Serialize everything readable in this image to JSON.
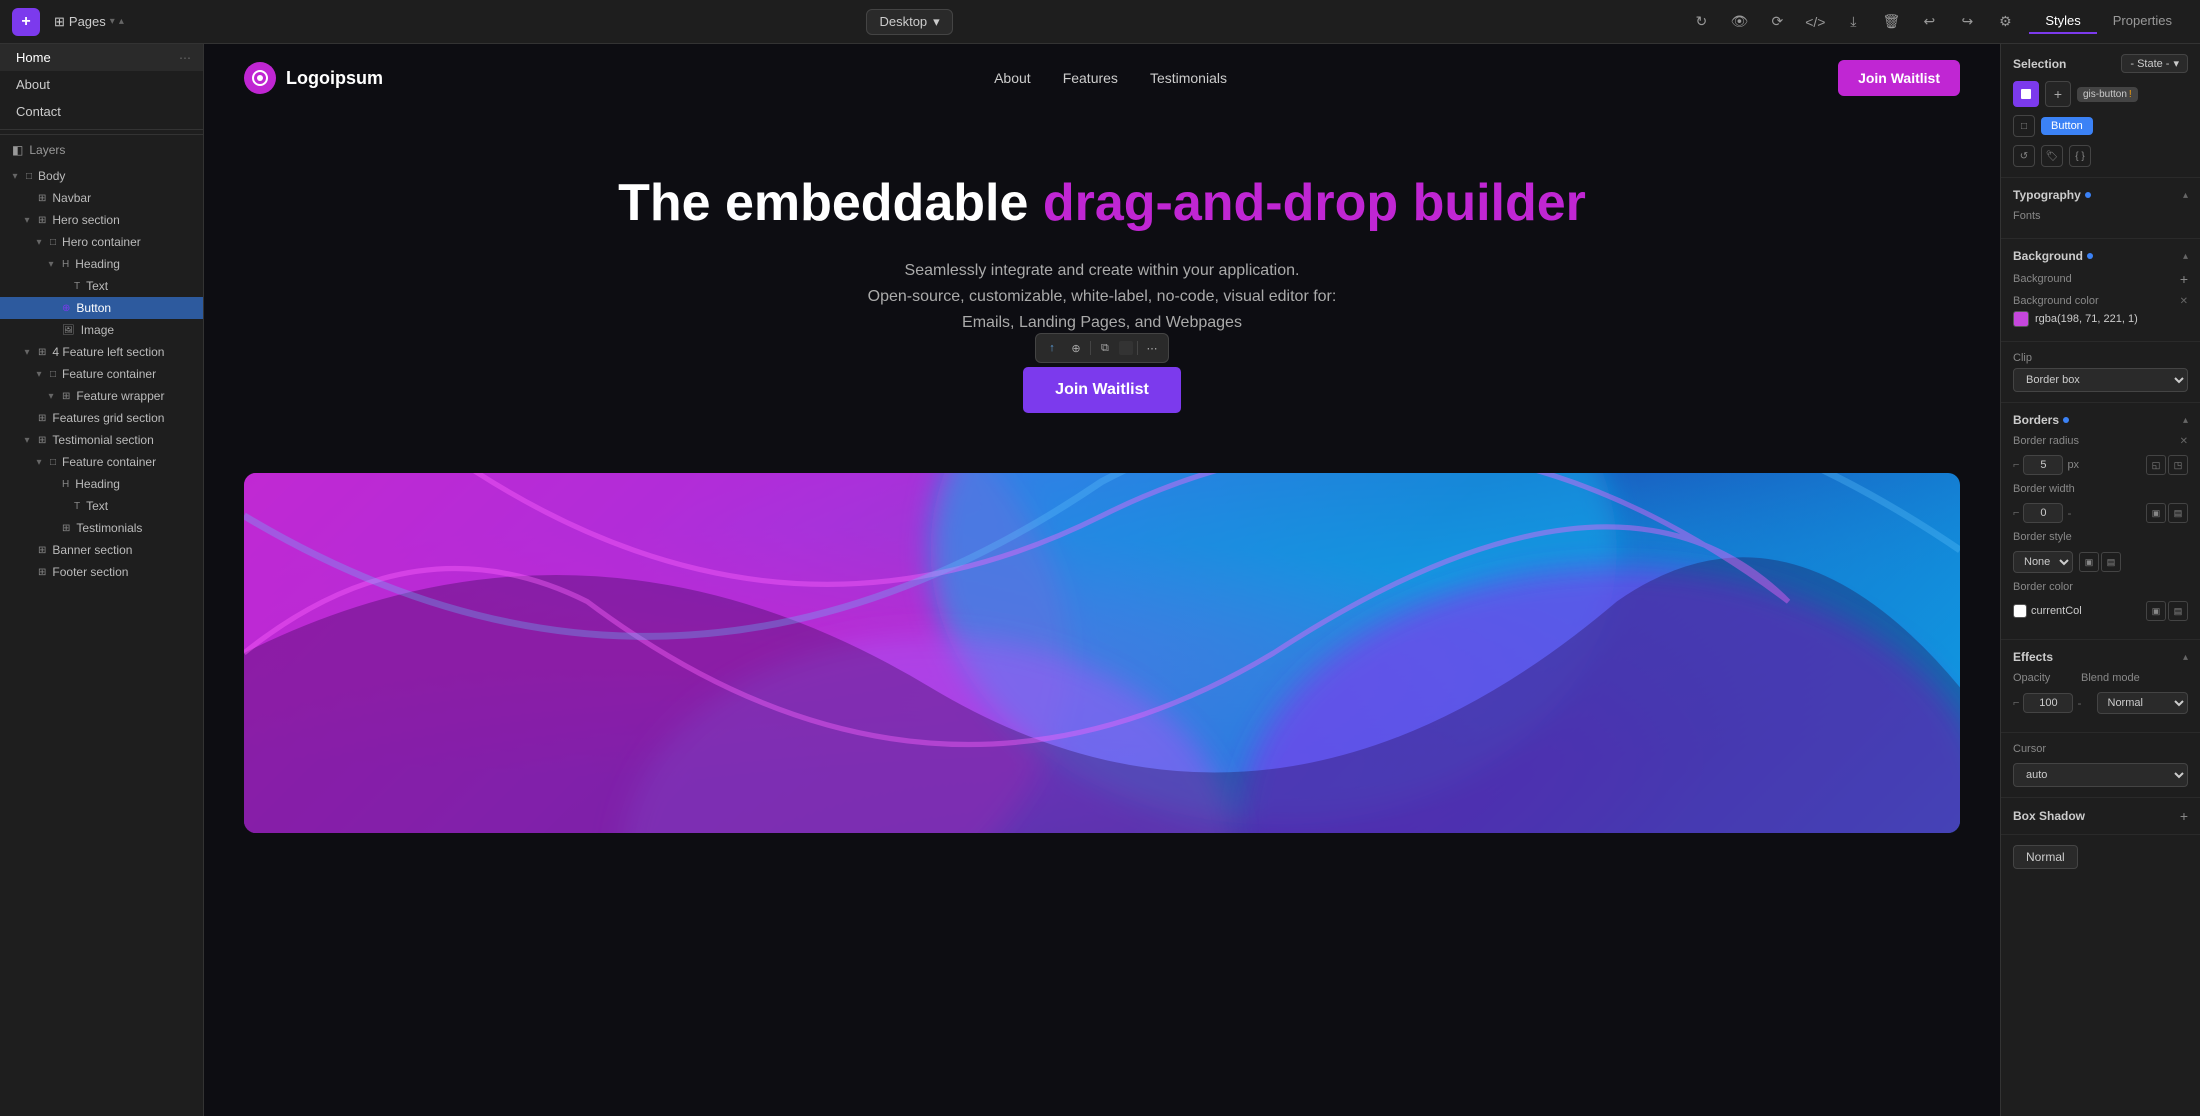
{
  "app": {
    "title": "Pages",
    "add_btn": "+",
    "device": "Desktop",
    "styles_tab": "Styles",
    "properties_tab": "Properties"
  },
  "pages": [
    {
      "id": "home",
      "label": "Home",
      "active": true
    },
    {
      "id": "about",
      "label": "About",
      "active": false
    },
    {
      "id": "contact",
      "label": "Contact",
      "active": false
    }
  ],
  "layers": {
    "title": "Layers",
    "items": [
      {
        "id": "body",
        "label": "Body",
        "indent": 0,
        "type": "box",
        "toggle": "▾",
        "expanded": true
      },
      {
        "id": "navbar",
        "label": "Navbar",
        "indent": 1,
        "type": "grid",
        "toggle": ""
      },
      {
        "id": "hero-section",
        "label": "Hero section",
        "indent": 1,
        "type": "grid",
        "toggle": "▾",
        "expanded": true
      },
      {
        "id": "hero-container",
        "label": "Hero container",
        "indent": 2,
        "type": "box",
        "toggle": "▾",
        "expanded": true
      },
      {
        "id": "heading",
        "label": "Heading",
        "indent": 3,
        "type": "heading",
        "toggle": "▾",
        "expanded": false
      },
      {
        "id": "text",
        "label": "Text",
        "indent": 4,
        "type": "text",
        "toggle": ""
      },
      {
        "id": "button",
        "label": "Button",
        "indent": 3,
        "type": "link",
        "toggle": "",
        "selected": true
      },
      {
        "id": "image",
        "label": "Image",
        "indent": 3,
        "type": "image",
        "toggle": ""
      },
      {
        "id": "feature-left-section",
        "label": "4 Feature left section",
        "indent": 1,
        "type": "grid",
        "toggle": "▾",
        "expanded": true
      },
      {
        "id": "feature-container",
        "label": "Feature container",
        "indent": 2,
        "type": "box",
        "toggle": "▾",
        "expanded": true
      },
      {
        "id": "feature-wrapper",
        "label": "Feature wrapper",
        "indent": 3,
        "type": "grid",
        "toggle": "▾",
        "expanded": false
      },
      {
        "id": "features-grid-section",
        "label": "Features grid section",
        "indent": 1,
        "type": "grid",
        "toggle": ""
      },
      {
        "id": "testimonial-section",
        "label": "Testimonial section",
        "indent": 1,
        "type": "grid",
        "toggle": "▾",
        "expanded": true
      },
      {
        "id": "feature-container-2",
        "label": "Feature container",
        "indent": 2,
        "type": "box",
        "toggle": "▾",
        "expanded": true
      },
      {
        "id": "heading-2",
        "label": "Heading",
        "indent": 3,
        "type": "heading",
        "toggle": ""
      },
      {
        "id": "text-2",
        "label": "Text",
        "indent": 4,
        "type": "text",
        "toggle": ""
      },
      {
        "id": "testimonials",
        "label": "Testimonials",
        "indent": 3,
        "type": "grid",
        "toggle": ""
      },
      {
        "id": "banner-section",
        "label": "Banner section",
        "indent": 1,
        "type": "grid",
        "toggle": ""
      },
      {
        "id": "footer-section",
        "label": "Footer section",
        "indent": 1,
        "type": "grid",
        "toggle": ""
      }
    ]
  },
  "website": {
    "logo": "Logoipsum",
    "nav_links": [
      "About",
      "Features",
      "Testimonials"
    ],
    "cta_btn": "Join Waitlist",
    "hero_title_normal": "The embeddable ",
    "hero_title_accent": "drag-and-drop builder",
    "hero_subtitle_line1": "Seamlessly integrate and create within your application.",
    "hero_subtitle_line2": "Open-source, customizable, white-label, no-code, visual editor for:",
    "hero_subtitle_line3": "Emails, Landing Pages, and Webpages",
    "hero_cta": "Join Waitlist"
  },
  "right_panel": {
    "selection_title": "Selection",
    "state_label": "- State -",
    "gis_badge": "gis-button",
    "button_badge": "Button",
    "typography_title": "Typography",
    "typography_subtitle": "Fonts",
    "background_title": "Background",
    "background_label": "Background",
    "background_color_label": "Background color",
    "background_color_value": "rgba(198, 71, 221, 1)",
    "clip_label": "Clip",
    "clip_value": "Border box",
    "borders_title": "Borders",
    "border_radius_label": "Border radius",
    "border_radius_value": "5",
    "border_radius_unit": "px",
    "border_width_label": "Border width",
    "border_width_value": "0",
    "border_style_label": "Border style",
    "border_style_value": "None",
    "border_color_label": "Border color",
    "border_color_value": "currentCol",
    "effects_title": "Effects",
    "opacity_label": "Opacity",
    "opacity_value": "100",
    "blend_mode_label": "Blend mode",
    "blend_mode_value": "Normal",
    "cursor_label": "Cursor",
    "cursor_value": "auto",
    "box_shadow_title": "Box Shadow",
    "normal_badge": "Normal"
  }
}
